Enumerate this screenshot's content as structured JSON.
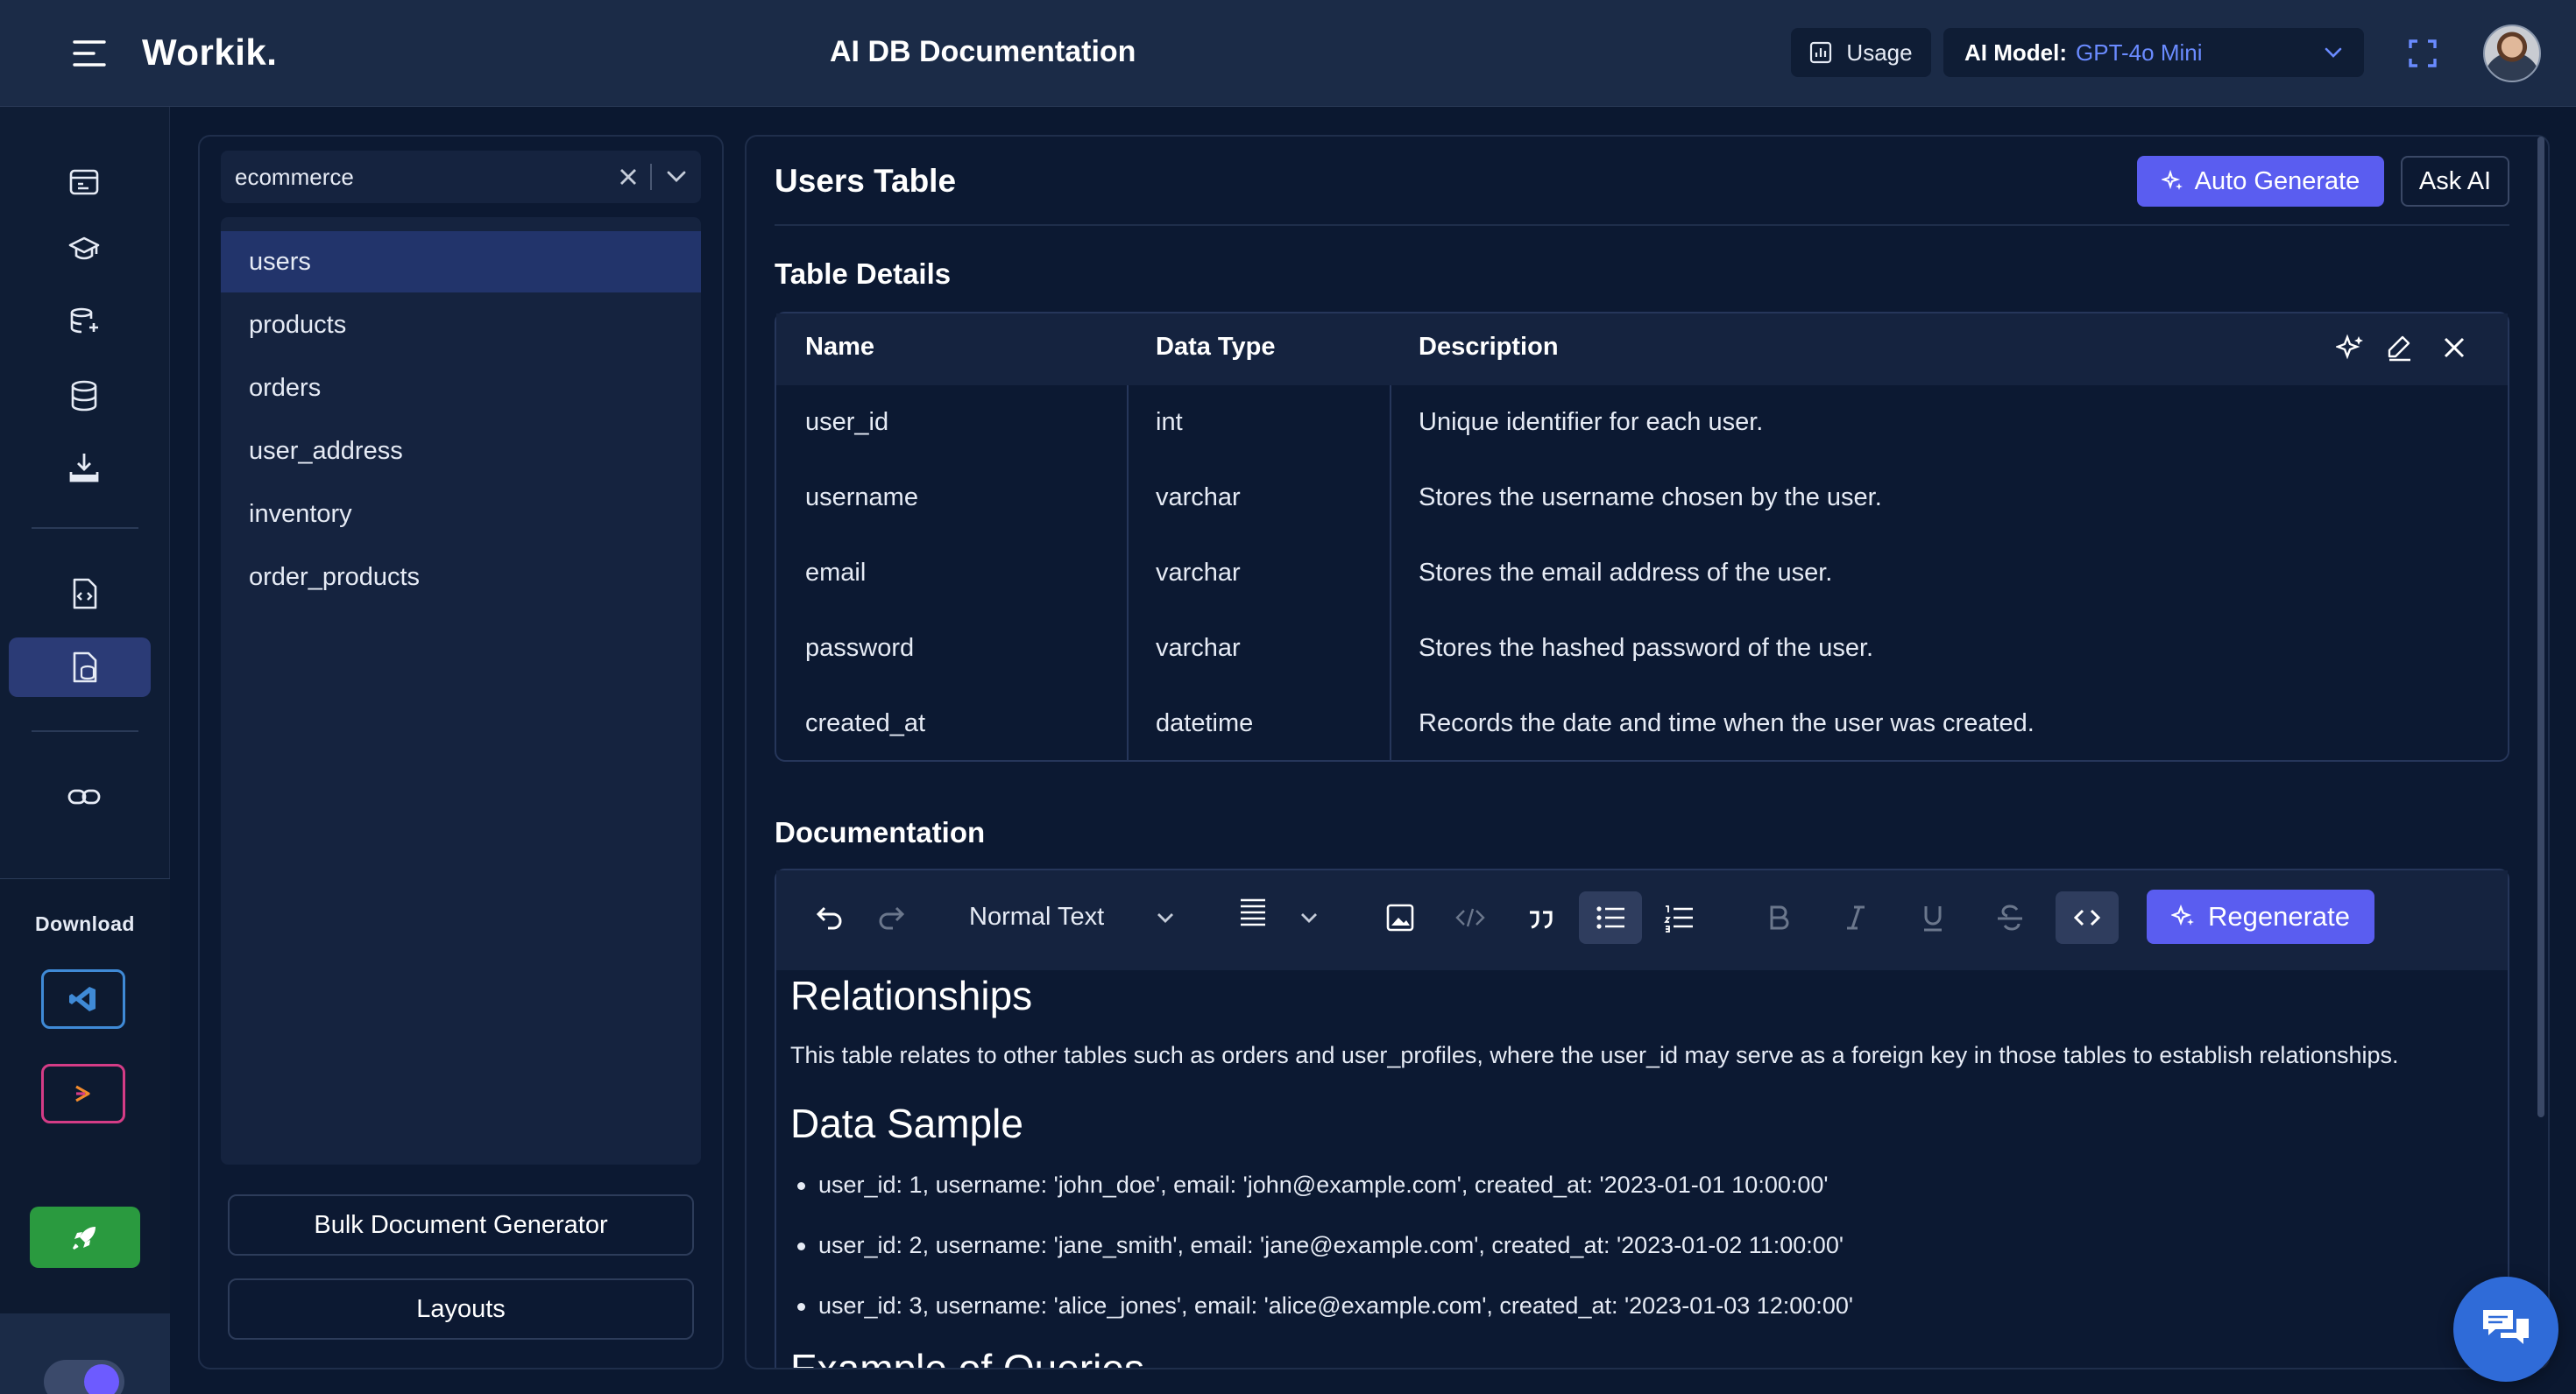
{
  "header": {
    "brand": "Workik.",
    "page_title": "AI DB Documentation",
    "usage_label": "Usage",
    "model_label": "AI Model:",
    "model_value": "GPT-4o Mini"
  },
  "rail": {
    "download_label": "Download",
    "icons": [
      "workspace-icon",
      "learn-icon",
      "db-user-icon",
      "database-icon",
      "download-tray-icon",
      "code-doc-icon",
      "db-doc-icon",
      "link-icon"
    ],
    "active_index": 6
  },
  "tables_panel": {
    "db_value": "ecommerce",
    "tables": [
      "users",
      "products",
      "orders",
      "user_address",
      "inventory",
      "order_products"
    ],
    "active_table": "users",
    "bulk_button": "Bulk Document Generator",
    "layouts_button": "Layouts"
  },
  "main": {
    "title": "Users Table",
    "auto_generate": "Auto Generate",
    "ask_ai": "Ask AI",
    "details_title": "Table Details",
    "columns": [
      "Name",
      "Data Type",
      "Description"
    ],
    "rows": [
      {
        "name": "user_id",
        "type": "int",
        "desc": "Unique identifier for each user."
      },
      {
        "name": "username",
        "type": "varchar",
        "desc": "Stores the username chosen by the user."
      },
      {
        "name": "email",
        "type": "varchar",
        "desc": "Stores the email address of the user."
      },
      {
        "name": "password",
        "type": "varchar",
        "desc": "Stores the hashed password of the user."
      },
      {
        "name": "created_at",
        "type": "datetime",
        "desc": "Records the date and time when the user was created."
      }
    ],
    "documentation_title": "Documentation",
    "toolbar": {
      "text_style": "Normal Text",
      "regenerate": "Regenerate"
    },
    "doc": {
      "relationships_heading": "Relationships",
      "relationships_text": "This table relates to other tables such as orders and user_profiles, where the user_id may serve as a foreign key in those tables to establish relationships.",
      "data_sample_heading": "Data Sample",
      "samples": [
        "user_id: 1, username: 'john_doe', email: 'john@example.com', created_at: '2023-01-01 10:00:00'",
        "user_id: 2, username: 'jane_smith', email: 'jane@example.com', created_at: '2023-01-02 11:00:00'",
        "user_id: 3, username: 'alice_jones', email: 'alice@example.com', created_at: '2023-01-03 12:00:00'"
      ],
      "next_heading": "Example of Queries"
    }
  },
  "colors": {
    "background": "#0b1830",
    "header": "#1b2b47",
    "accent": "#5a5df0",
    "model_value": "#6a8bff",
    "active_item": "#22346b"
  }
}
